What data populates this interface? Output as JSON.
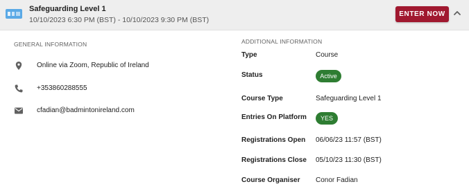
{
  "header": {
    "title": "Safeguarding Level 1",
    "datetime": "10/10/2023 6:30 PM (BST) - 10/10/2023 9:30 PM (BST)",
    "enter_label": "ENTER NOW",
    "logo_icon": "badminton-ireland-logo",
    "collapse_icon": "chevron-up-icon",
    "accent_color": "#a0182f"
  },
  "general": {
    "heading": "GENERAL INFORMATION",
    "location": "Online via Zoom, Republic of Ireland",
    "phone": "+353860288555",
    "email": "cfadian@badmintonireland.com",
    "icons": [
      "location-pin-icon",
      "phone-icon",
      "email-icon"
    ]
  },
  "additional": {
    "heading": "ADDITIONAL INFORMATION",
    "type_label": "Type",
    "type_value": "Course",
    "status_label": "Status",
    "status_value": "Active",
    "course_type_label": "Course Type",
    "course_type_value": "Safeguarding Level 1",
    "entries_label": "Entries On Platform",
    "entries_value": "YES",
    "reg_open_label": "Registrations Open",
    "reg_open_value": "06/06/23 11:57 (BST)",
    "reg_close_label": "Registrations Close",
    "reg_close_value": "05/10/23 11:30 (BST)",
    "organiser_label": "Course Organiser",
    "organiser_value": "Conor Fadian",
    "pill_color": "#2e7d32"
  }
}
